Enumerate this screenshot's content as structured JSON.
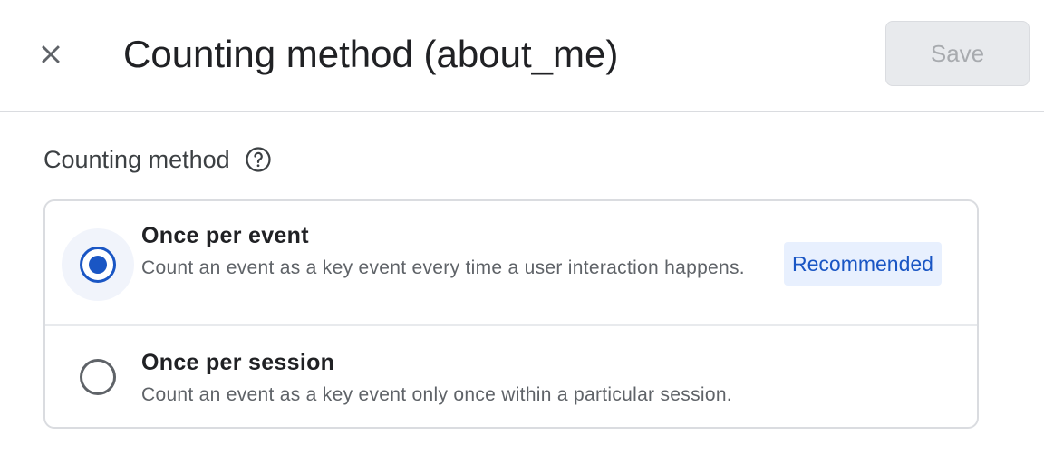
{
  "header": {
    "close_icon": "close-icon",
    "title": "Counting method (about_me)",
    "save_label": "Save"
  },
  "section": {
    "label": "Counting method",
    "help_icon": "help-circle-icon"
  },
  "options": [
    {
      "title": "Once per event",
      "description": "Count an event as a key event every time a user interaction happens.",
      "badge": "Recommended",
      "selected": true
    },
    {
      "title": "Once per session",
      "description": "Count an event as a key event only once within a particular session.",
      "selected": false
    }
  ],
  "colors": {
    "accent": "#1a56c4",
    "badge_bg": "#e8f0fe",
    "save_disabled_bg": "#e8eaed",
    "save_disabled_text": "#a8abaf"
  }
}
